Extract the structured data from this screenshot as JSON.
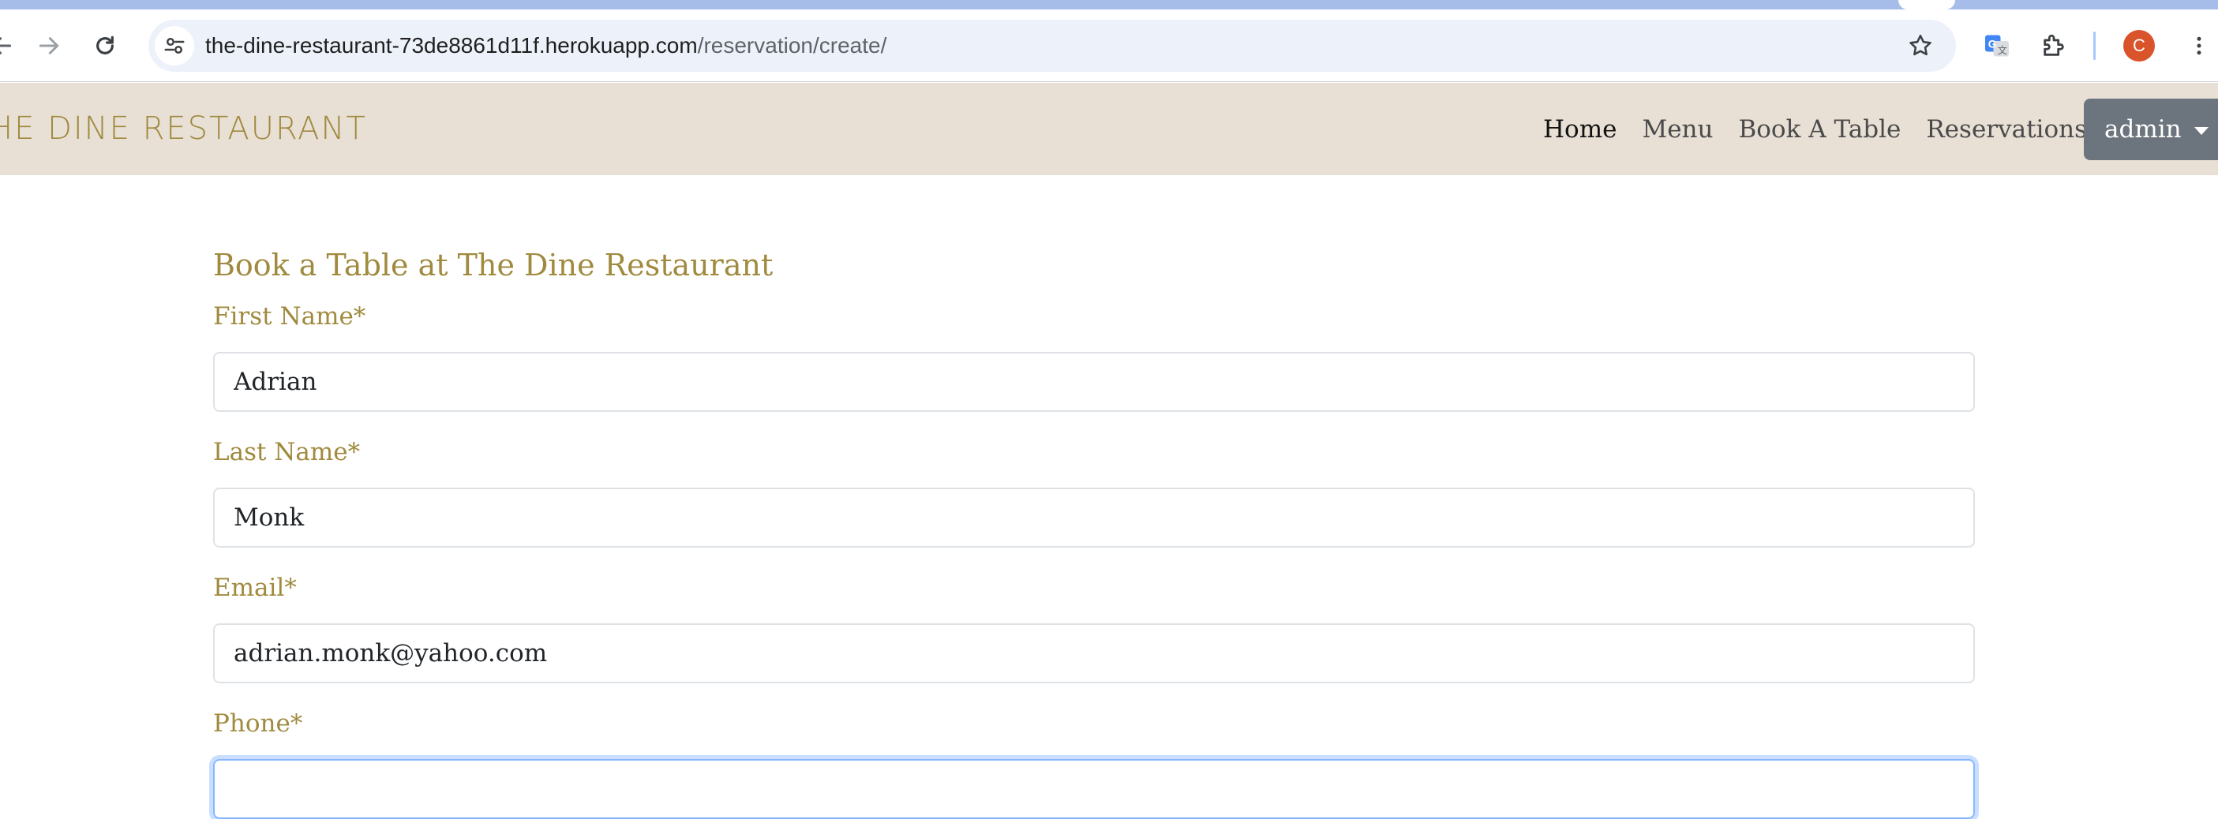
{
  "browser": {
    "url_host": "the-dine-restaurant-73de8861d11f.herokuapp.com",
    "url_path": "/reservation/create/",
    "profile_initial": "C"
  },
  "navbar": {
    "brand": "HE DINE RESTAURANT",
    "links": [
      "Home",
      "Menu",
      "Book A Table",
      "Reservations"
    ],
    "user_menu": "admin"
  },
  "form": {
    "title": "Book a Table at The Dine Restaurant",
    "fields": [
      {
        "label": "First Name*",
        "value": "Adrian"
      },
      {
        "label": "Last Name*",
        "value": "Monk"
      },
      {
        "label": "Email*",
        "value": "adrian.monk@yahoo.com"
      },
      {
        "label": "Phone*",
        "value": ""
      }
    ]
  },
  "colors": {
    "brand_gold": "#a08a3e",
    "navbar_bg": "#e8dfd5",
    "admin_button": "#6c757d",
    "focus_ring": "#86b7fe"
  }
}
